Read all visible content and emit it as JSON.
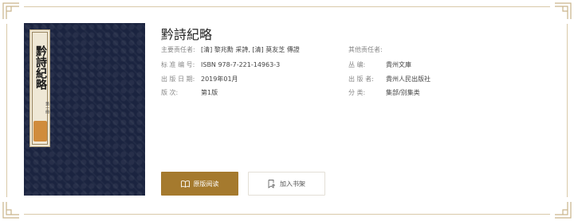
{
  "book": {
    "title": "黔詩紀略",
    "cover_title": "黔詩紀略",
    "cover_subtitle": "第一冊"
  },
  "details_left": [
    {
      "label": "主要责任者:",
      "value": "[清] 黎兆勳 采詩, [清] 莫友芝 傳證"
    },
    {
      "label": "标 准 编 号:",
      "value": "ISBN 978-7-221-14963-3"
    },
    {
      "label": "出 版 日 期:",
      "value": "2019年01月"
    },
    {
      "label": "版      次:",
      "value": "第1版"
    }
  ],
  "details_right": [
    {
      "label": "其他责任者:",
      "value": ""
    },
    {
      "label": "丛      编:",
      "value": "貴州文庫"
    },
    {
      "label": "出    版    者:",
      "value": "貴州人民出版社"
    },
    {
      "label": "分      类:",
      "value": "集部/别集类"
    }
  ],
  "actions": {
    "read_label": "原版阅读",
    "shelf_label": "加入书架"
  },
  "colors": {
    "accent": "#a57a2e",
    "cover": "#1b2440",
    "frame": "#d9c9a8"
  }
}
